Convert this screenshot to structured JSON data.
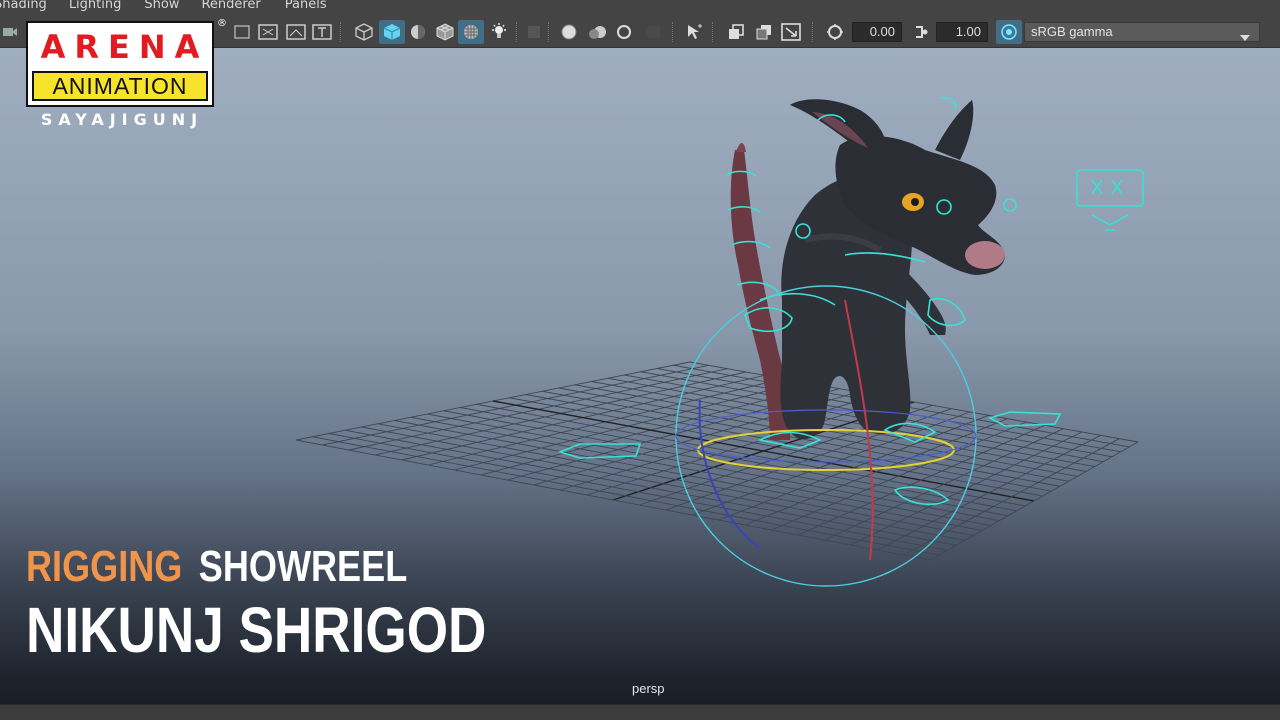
{
  "menu": {
    "items": [
      "Shading",
      "Lighting",
      "Show",
      "Renderer",
      "Panels"
    ]
  },
  "toolbar": {
    "exposure_value": "0.00",
    "gamma_value": "1.00",
    "color_space": "sRGB gamma"
  },
  "logo": {
    "brand": "ARENA",
    "sub": "ANIMATION",
    "registered": "®",
    "location": "SAYAJIGUNJ"
  },
  "title": {
    "accent": "RIGGING",
    "rest": "SHOWREEL",
    "name": "NIKUNJ SHRIGOD"
  },
  "viewport": {
    "camera": "persp"
  },
  "colors": {
    "accent": "#f0934b",
    "control_curve": "#38e2d6",
    "logo_red": "#e21b23",
    "logo_yellow": "#f7e32a"
  }
}
